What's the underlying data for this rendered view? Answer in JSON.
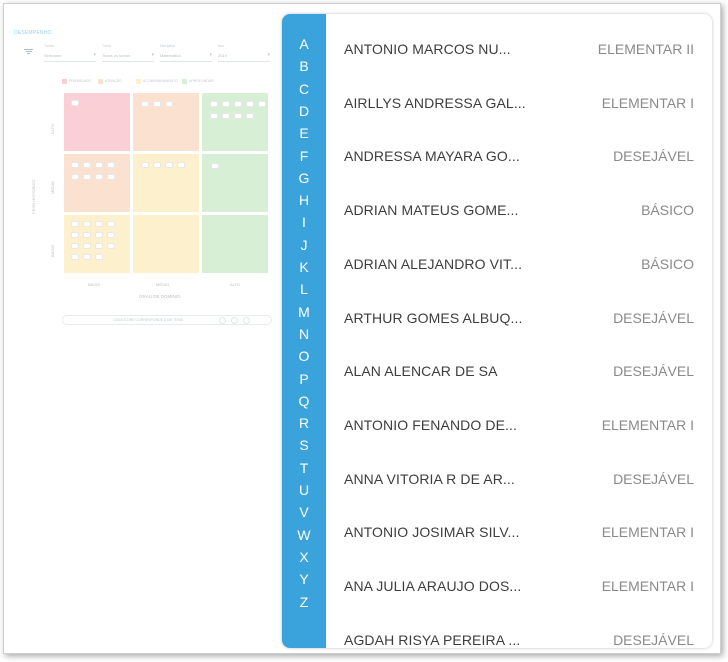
{
  "background": {
    "title": "DESEMPENHO",
    "filters": [
      {
        "label": "Turma",
        "value": "Selecione"
      },
      {
        "label": "Turno",
        "value": "Todos os turnos"
      },
      {
        "label": "Disciplina",
        "value": "Matemática"
      },
      {
        "label": "Ano",
        "value": "2019"
      }
    ],
    "legend": [
      "PRIORIDADE",
      "ATENÇÃO",
      "ACOMPANHAMENTO",
      "APROFUNDAR"
    ],
    "y_axis_title": "PESO HISTÓRICO",
    "y_labels": [
      "ALTO",
      "MÉDIO",
      "BAIXO"
    ],
    "x_labels": [
      "BAIXO",
      "MÉDIO",
      "ALTO"
    ],
    "x_axis_title": "GRAU DE DOMÍNIO",
    "footer_text": "CADA ÍCONE CORRESPONDE A UM TEMA",
    "colors": {
      "red": "#f7a9b4",
      "orange": "#f9c9a8",
      "yellow": "#fde4a3",
      "green": "#b7e2b1"
    }
  },
  "alphabet": [
    "A",
    "B",
    "C",
    "D",
    "E",
    "F",
    "G",
    "H",
    "I",
    "J",
    "K",
    "L",
    "M",
    "N",
    "O",
    "P",
    "Q",
    "R",
    "S",
    "T",
    "U",
    "V",
    "W",
    "X",
    "Y",
    "Z"
  ],
  "students": [
    {
      "name": "ANTONIO MARCOS NU...",
      "level": "ELEMENTAR II"
    },
    {
      "name": "AIRLLYS ANDRESSA GAL...",
      "level": "ELEMENTAR I"
    },
    {
      "name": "ANDRESSA MAYARA GO...",
      "level": "DESEJÁVEL"
    },
    {
      "name": "ADRIAN MATEUS GOME...",
      "level": "BÁSICO"
    },
    {
      "name": "ADRIAN ALEJANDRO VIT...",
      "level": "BÁSICO"
    },
    {
      "name": "ARTHUR GOMES ALBUQ...",
      "level": "DESEJÁVEL"
    },
    {
      "name": "ALAN ALENCAR DE SA",
      "level": "DESEJÁVEL"
    },
    {
      "name": "ANTONIO FENANDO DE...",
      "level": "ELEMENTAR I"
    },
    {
      "name": "ANNA VITORIA R DE AR...",
      "level": "DESEJÁVEL"
    },
    {
      "name": "ANTONIO JOSIMAR SILV...",
      "level": "ELEMENTAR I"
    },
    {
      "name": "ANA JULIA ARAUJO DOS...",
      "level": "ELEMENTAR I"
    },
    {
      "name": "AGDAH RISYA PEREIRA ...",
      "level": "DESEJÁVEL"
    }
  ],
  "theme": {
    "accent": "#3ba3dc"
  }
}
